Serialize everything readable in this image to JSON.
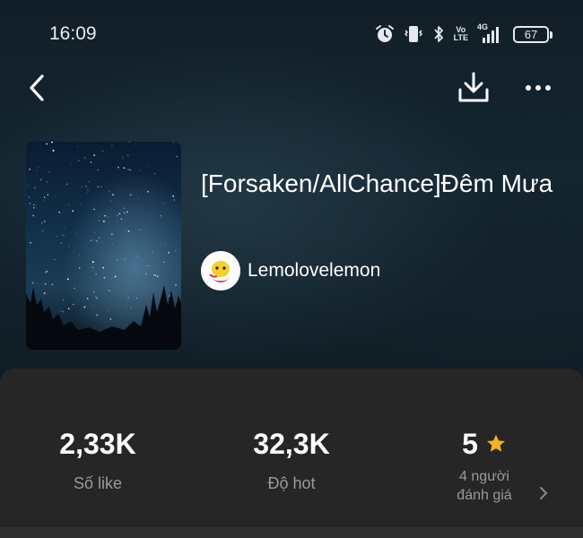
{
  "status_bar": {
    "time": "16:09",
    "volte_top": "Vo",
    "volte_bottom": "LTE",
    "network": "4G",
    "battery": "67",
    "icons": [
      "alarm-icon",
      "vibrate-icon",
      "bluetooth-icon",
      "volte-icon",
      "signal-icon",
      "battery-icon"
    ]
  },
  "nav": {
    "icons": [
      "back-icon",
      "download-icon",
      "more-icon"
    ]
  },
  "story": {
    "title": "[Forsaken/AllChance]Đêm Mưa",
    "author": "Lemolovelemon"
  },
  "stats": {
    "likes_value": "2,33K",
    "likes_label": "Số like",
    "hot_value": "32,3K",
    "hot_label": "Độ hot",
    "rating_value": "5",
    "rating_label_line1": "4 người",
    "rating_label_line2": "đánh giá"
  },
  "colors": {
    "panel_bg": "#262626",
    "star": "#f5b323",
    "label_gray": "#9a9a9a"
  }
}
